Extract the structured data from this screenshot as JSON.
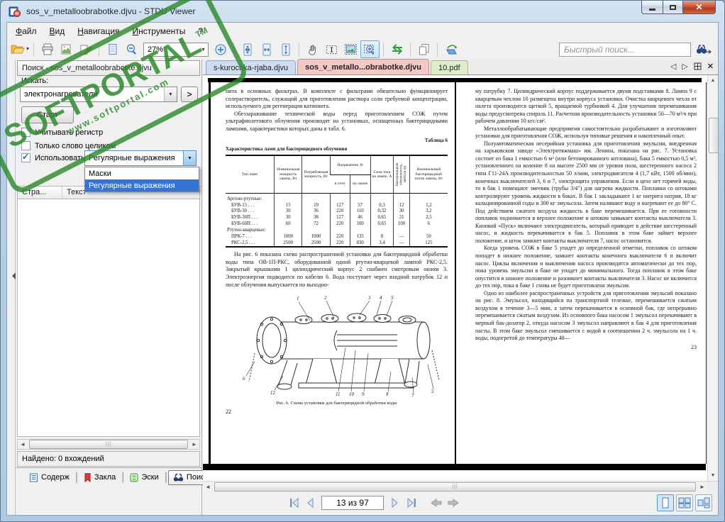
{
  "window": {
    "title": "sos_v_metalloobrabotke.djvu - STDU Viewer"
  },
  "menu": {
    "items": [
      {
        "id": "file",
        "label": "Файл"
      },
      {
        "id": "view",
        "label": "Вид"
      },
      {
        "id": "navigation",
        "label": "Навигация"
      },
      {
        "id": "tools",
        "label": "Инструменты"
      },
      {
        "id": "help",
        "label": "?"
      }
    ]
  },
  "toolbar": {
    "zoom_value": "27%",
    "quick_search_placeholder": "Быстрый поиск...",
    "items": [
      {
        "icon": "open-folder",
        "name": "open-button",
        "dropdown": true
      },
      {
        "sep": true
      },
      {
        "icon": "print",
        "name": "print-button"
      },
      {
        "icon": "export-image",
        "name": "export-image-button"
      },
      {
        "icon": "edit-pencil",
        "name": "edit-annotation-button"
      },
      {
        "sep": true
      },
      {
        "icon": "page",
        "name": "page-tool-button"
      },
      {
        "icon": "zoom-out",
        "name": "zoom-out-button"
      },
      {
        "combo": true
      },
      {
        "icon": "zoom-in-circle",
        "name": "zoom-in-button"
      },
      {
        "sep": true
      },
      {
        "icon": "fit-page",
        "name": "fit-page-button"
      },
      {
        "icon": "fit-width",
        "name": "fit-width-button"
      },
      {
        "icon": "fit-height",
        "name": "fit-height-button"
      },
      {
        "sep": true
      },
      {
        "icon": "hand",
        "name": "hand-tool-button"
      },
      {
        "icon": "select-text",
        "name": "select-text-button"
      },
      {
        "icon": "select-image",
        "name": "select-image-button"
      },
      {
        "icon": "zoom-region",
        "name": "zoom-region-button",
        "active": true
      },
      {
        "sep": true
      },
      {
        "icon": "swap-arrows",
        "name": "swap-pages-button"
      },
      {
        "sep": true
      },
      {
        "icon": "copy-pages",
        "name": "copy-button"
      },
      {
        "sep": true
      },
      {
        "icon": "rotate-stack",
        "name": "rotate-page-button"
      }
    ]
  },
  "watermark": {
    "brand": "SOFTPORTAL",
    "trademark": "TM",
    "url": "www.softportal.com",
    "color": "#2e8a2e"
  },
  "search_panel": {
    "header": "Поиск - sos_v_metalloobrabotke.djvu",
    "find_label": "Искать:",
    "query": "электронагреватели",
    "start_button": "Старт",
    "checkboxes": [
      {
        "label": "Учитывать регистр",
        "checked": false
      },
      {
        "label": "Только слово целиком",
        "checked": false
      }
    ],
    "use_label": "Использовать:",
    "use_checked": true,
    "use_value": "Регулярные выражения",
    "dropdown_options": [
      "Маски",
      "Регулярные выражения"
    ],
    "dropdown_selected_index": 1,
    "results_columns": [
      "Стра...",
      "Текст"
    ],
    "status": "Найдено: 0 вхождений",
    "tabs": [
      {
        "label": "Содерж",
        "icon": "contents",
        "active": false
      },
      {
        "label": "Закла",
        "icon": "bookmark",
        "active": false
      },
      {
        "label": "Эски",
        "icon": "thumbnails",
        "active": false
      },
      {
        "label": "Поиск",
        "icon": "binoculars",
        "active": true
      }
    ]
  },
  "doc_tabs": [
    {
      "label": "s-kurochka-rjaba.djvu",
      "color": "#cdddf2",
      "border": "#8fa9c9",
      "active": false
    },
    {
      "label": "sos_v_metallo...obrabotke.djvu",
      "color": "#f4c9c5",
      "border": "#c49390",
      "active": true
    },
    {
      "label": "10.pdf",
      "color": "#ddeec9",
      "border": "#a3bf85",
      "active": false
    }
  ],
  "tabbar_controls": [
    "scroll-tabs-left",
    "scroll-tabs-right",
    "tab-list",
    "close-tab"
  ],
  "pages": {
    "left": {
      "number": "22",
      "paragraphs": [
        "нита в основных фильтрах. В комплекте с фильтрами обязательно функционирует солерастворитель, служащий для приготовления раствора соли требуемой концентрации, используемого для регенерации катионита.",
        "Обеззараживание технической воды перед приготовлением СОЖ путем ультрафиолетового облучения производят на установках, оснащенных бактерицидными лампами, характеристики которых даны в табл. 6."
      ],
      "table": {
        "label": "Таблица 6",
        "title": "Характеристика ламп для бактерицидного облучения",
        "col1": "Тип ламп",
        "col2": "Номинальная мощность лампы, Вт",
        "col3": "Потребляемая мощность, Вт",
        "col45_group": "Напряжение, В",
        "col4": "в сети",
        "col5": "на лампе",
        "col6": "Сила тока на лампе, А",
        "col7": "Бактерицидная облученность, мкб/(см·м)",
        "col8": "Номинальный бактерицидный поток лампы, Вт",
        "rows": [
          [
            "Аргоно-ртутные:",
            "",
            "",
            "",
            "",
            "",
            "",
            ""
          ],
          [
            "БУВ-15 . . .",
            "15",
            "19",
            "127",
            "57",
            "0,3",
            "12",
            "1,2"
          ],
          [
            "БУВ-30 . . .",
            "30",
            "36",
            "220",
            "110",
            "0,32",
            "30",
            "3,2"
          ],
          [
            "БУВ-30П . . .",
            "30",
            "38",
            "127",
            "46",
            "0,65",
            "21",
            "2,5"
          ],
          [
            "БУВ-60П . . .",
            "60",
            "72",
            "220",
            "100",
            "0,65",
            "100",
            "6"
          ],
          [
            "Ртутно-кварцевые:",
            "",
            "",
            "",
            "",
            "",
            "",
            ""
          ],
          [
            "ПРК-7 . . .",
            "1000",
            "1000",
            "220",
            "135",
            "8",
            "—",
            "50"
          ],
          [
            "РКС-2,5 . . .",
            "2500",
            "2500",
            "220",
            "830",
            "3,4",
            "—",
            "125"
          ]
        ]
      },
      "post_table_paragraph": "На рис. 6 показана схема распространенной установки для бактерицидной обработки воды типа ОВ-1П-РКС, оборудованной одной ртутно-кварцевой лампой РКС-2,5. Закрытый крышками 1 цилиндрический корпус 2 снабжен смотровым окном 3. Электроэнергия подводится по кабелю 6. Вода поступает через входной патрубок 12 и после облучения выпускается по выходно-",
      "figure_caption": "Рис. 6. Схема установки для бактерицидной обработки воды"
    },
    "right": {
      "number": "23",
      "paragraphs": [
        "му патрубку 7. Цилиндрический корпус поддерживается двумя подставками 8. Лампа 9 с кварцевым чехлом 10 размещена внутри корпуса установки. Очистка кварцевого чехла от налета производится щеткой 5, вращаемой турбинкой 4. Для улучшения перемешивания воды предусмотрена спираль 11. Расчетная производительность установки 50—70 м³/ч при рабочем давлении 10 кгс/см².",
        "Металлообрабатывающие предприятия самостоятельно разрабатывают и изготовляют установки для приготовления СОЖ, используя типовые решения и накопленный опыт.",
        "Полуавтоматическая несерийная установка для приготовления эмульсии, внедренная на харьковском заводе «Электротяжмаш» им. Ленина, показана на рис. 7. Установка состоит из бака 1 емкостью 6 м³ (или бетонированного котлована), бака 5 емкостью 0,5 м³, установленного на колонне 8 на высоте 2500 мм от уровня пола, шестеренного насоса 2 типа Г11-24А производительностью 50 л/мин, электродвигателя 4 (1,7 кВт, 1500 об/мин), конечных выключателей 3, 6 и 7, электрощита управления. Если в цехе нет горячей воды, то в бак 1 помещают змеевик (трубы 3/4\") для нагрева жидкости. Поплавки со штоками контролируют уровень жидкости в баках. В бак 1 закладывают 1 кг нитрита натрия, 18 кг кальцинированной соды и 300 кг эмульсола. Затем наливают воду и нагревают ее до 80° С. Под действием сжатого воздуха жидкость в баке перемешивается. При ее готовности поплавок поднимается в верхнее положение и штоком замыкает контакты выключателя 3. Кнопкой «Пуск» включают электродвигатель, который приводит в действие шестеренный насос, и жидкость перекачивается в бак 5. Поплавок в этом баке займет верхнее положение, и шток замкнет контакты выключателя 7, насос остановится.",
        "Когда уровень СОЖ в баке 5 упадет до определенной отметки, поплавок со штоком попадет в нижнее положение, замкнет контакты конечного выключателя 6 и включит насос. Циклы включения и выключения насоса производятся автоматически до тех пор, пока уровень эмульсии в баке не упадет до минимального. Тогда поплавок в этом баке опустится в нижнее положение и разомкнет контакты выключателя 3. Насос не включится до тех пор, пока в баке 1 снова не будет приготовлена эмульсия.",
        "Одно из наиболее распространенных устройств для приготовления эмульсий показано на рис. 8. Эмульсол, находящийся на транспортной тележке, перемешивается сжатым воздухом в течение 3—5 мин, а затем перекачивается в основной бак, где непрерывно перемешивается сжатым воздухом. Из основного бака насосом 1 эмульсол перекачивают в мерный бак-дозатор 2, откуда насосом 3 эмульсол направляют в бак 4 для приготовления пасты. В этом баке эмульсол смешивается с водой в соотношении 2 ч. эмульсола на 1 ч. воды, подогретой до температуры 40—"
      ]
    }
  },
  "nav": {
    "page_field": "13 из 97"
  }
}
